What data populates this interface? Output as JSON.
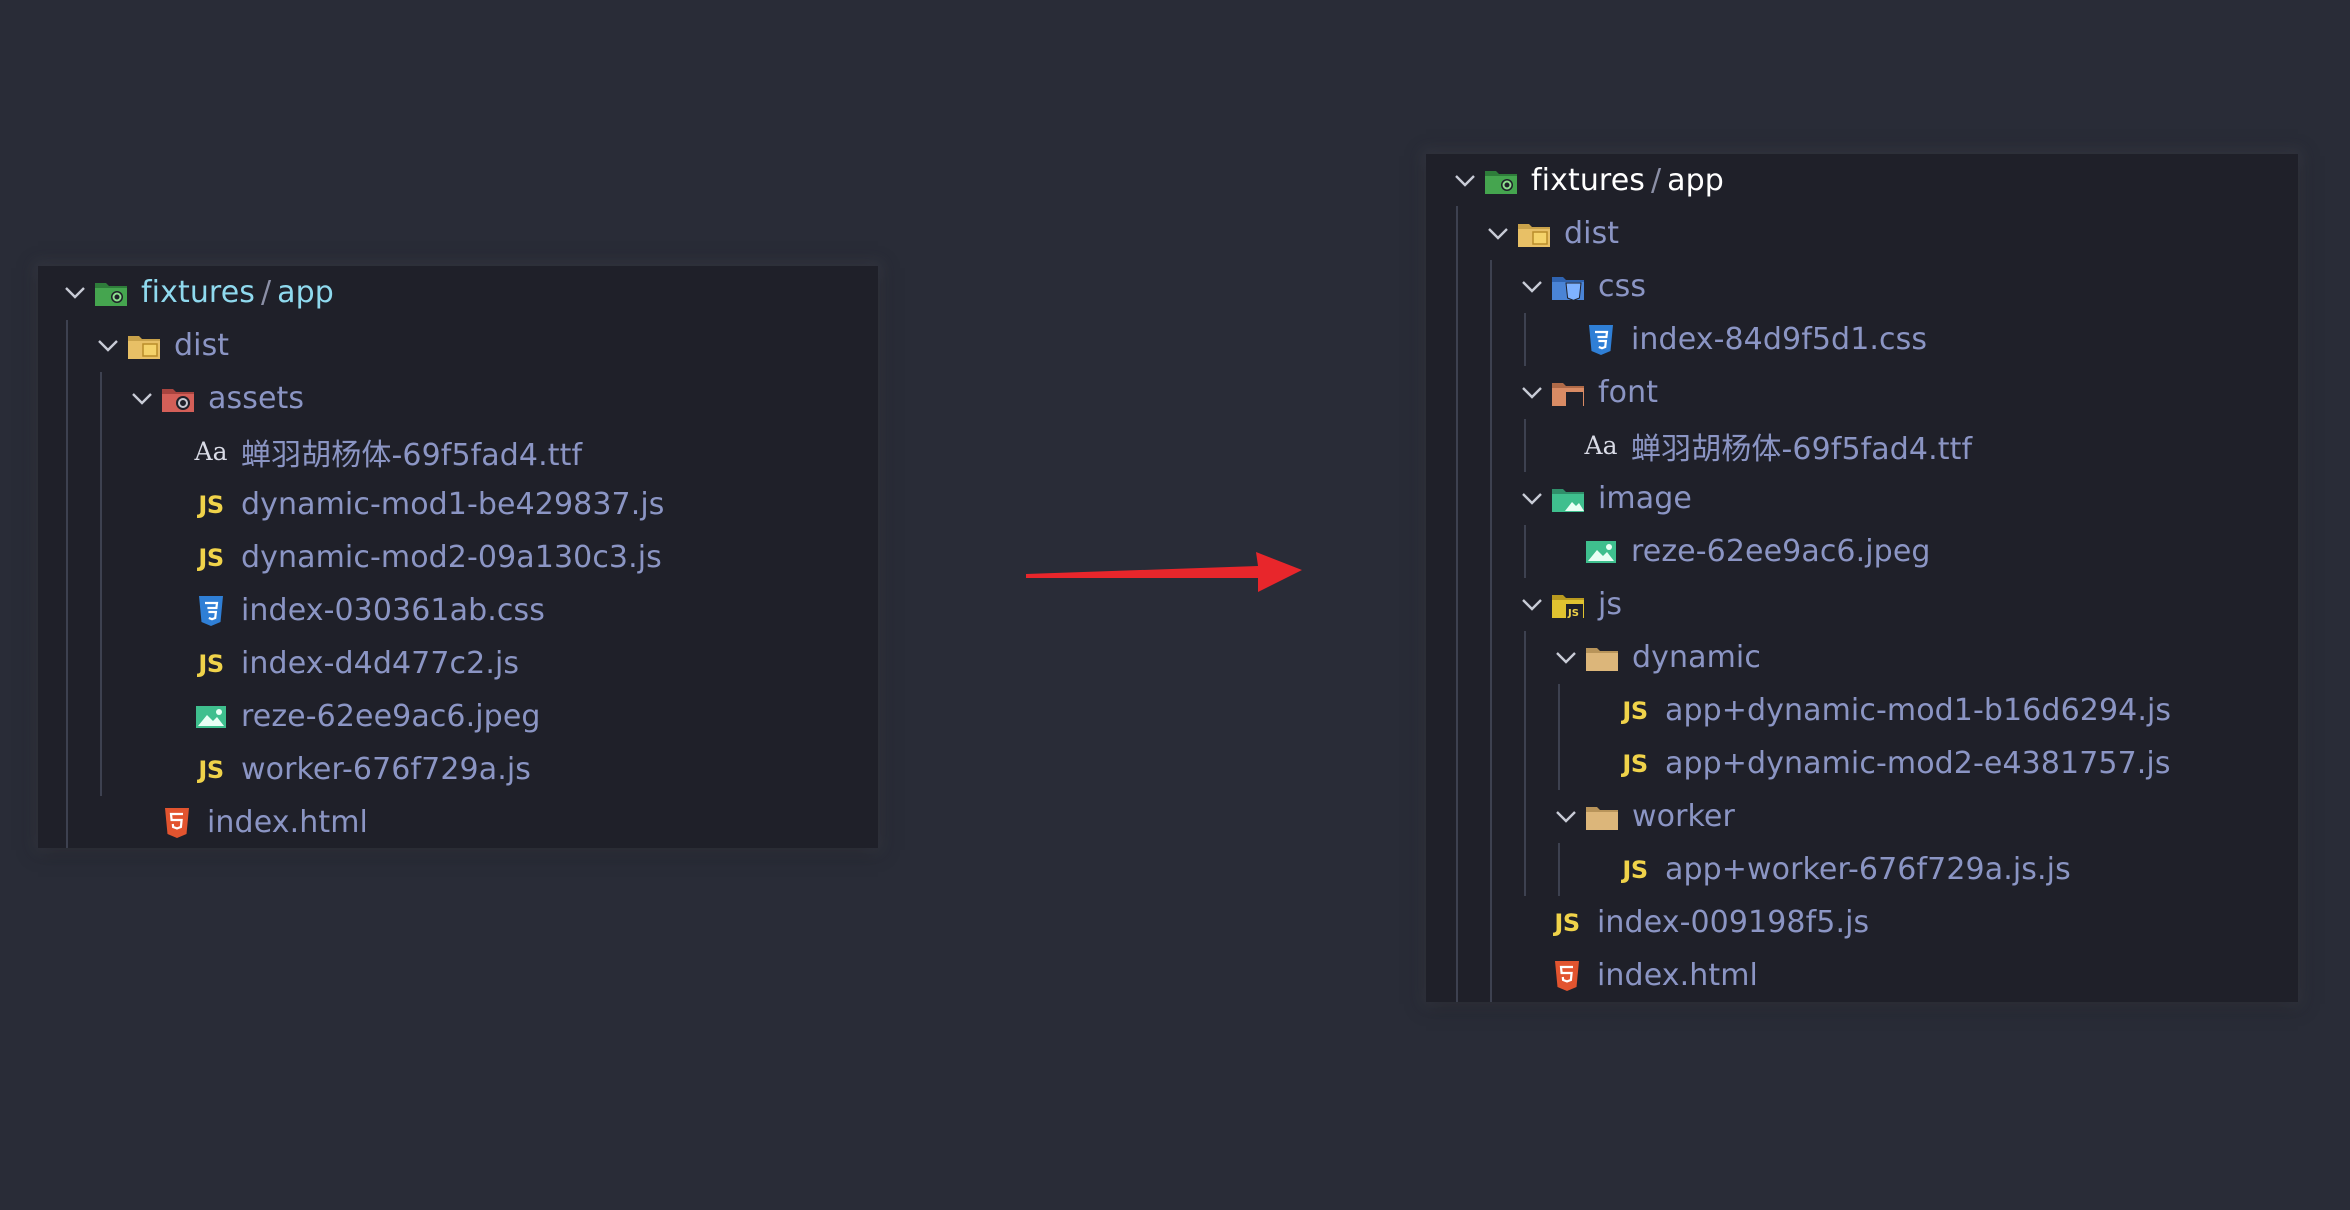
{
  "left_tree": {
    "root": {
      "label_left": "fixtures",
      "separator": "/",
      "label_right": "app"
    },
    "dist": {
      "label": "dist"
    },
    "assets": {
      "label": "assets"
    },
    "files": [
      {
        "label": "蝉羽胡杨体-69f5fad4.ttf",
        "icon": "font-file-icon",
        "icon_text": "Aa"
      },
      {
        "label": "dynamic-mod1-be429837.js",
        "icon": "js-file-icon",
        "icon_text": "JS"
      },
      {
        "label": "dynamic-mod2-09a130c3.js",
        "icon": "js-file-icon",
        "icon_text": "JS"
      },
      {
        "label": "index-030361ab.css",
        "icon": "css-file-icon"
      },
      {
        "label": "index-d4d477c2.js",
        "icon": "js-file-icon",
        "icon_text": "JS"
      },
      {
        "label": "reze-62ee9ac6.jpeg",
        "icon": "image-file-icon"
      },
      {
        "label": "worker-676f729a.js",
        "icon": "js-file-icon",
        "icon_text": "JS"
      }
    ],
    "index_html": {
      "label": "index.html"
    }
  },
  "right_tree": {
    "root": {
      "label_left": "fixtures",
      "separator": "/",
      "label_right": "app"
    },
    "dist": {
      "label": "dist"
    },
    "css_folder": {
      "label": "css"
    },
    "css_file": {
      "label": "index-84d9f5d1.css"
    },
    "font_folder": {
      "label": "font"
    },
    "font_file": {
      "label": "蝉羽胡杨体-69f5fad4.ttf",
      "icon_text": "Aa"
    },
    "image_folder": {
      "label": "image"
    },
    "image_file": {
      "label": "reze-62ee9ac6.jpeg"
    },
    "js_folder": {
      "label": "js"
    },
    "dynamic_folder": {
      "label": "dynamic"
    },
    "dynamic_files": [
      {
        "label": "app+dynamic-mod1-b16d6294.js",
        "icon_text": "JS"
      },
      {
        "label": "app+dynamic-mod2-e4381757.js",
        "icon_text": "JS"
      }
    ],
    "worker_folder": {
      "label": "worker"
    },
    "worker_file": {
      "label": "app+worker-676f729a.js.js",
      "icon_text": "JS"
    },
    "index_js": {
      "label": "index-009198f5.js",
      "icon_text": "JS"
    },
    "index_html": {
      "label": "index.html"
    }
  },
  "colors": {
    "background": "#292c37",
    "panel": "#1f2029",
    "label": "#8b95c4",
    "root_label_left_panel": "#8fd9ee",
    "root_label_right_panel": "#ffffff",
    "arrow": "#e8262b"
  }
}
